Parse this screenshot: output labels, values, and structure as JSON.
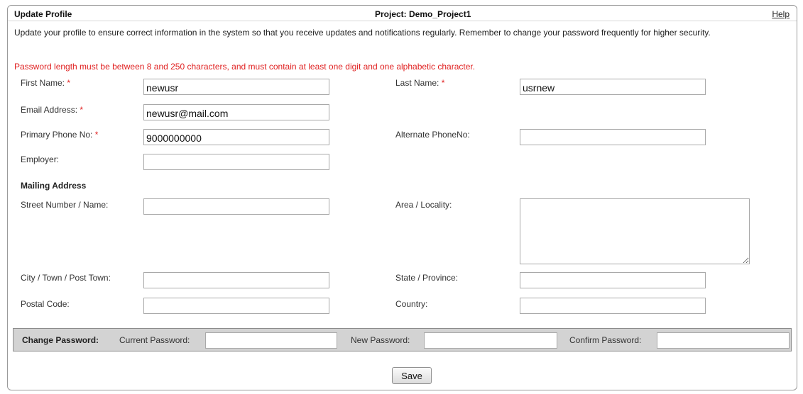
{
  "header": {
    "title": "Update Profile",
    "project": "Project: Demo_Project1",
    "help": "Help"
  },
  "intro_text": "Update your profile to ensure correct information in the system so that you receive updates and notifications regularly. Remember to change your password frequently for higher security.",
  "password_rule": "Password length must be between 8 and 250 characters, and must contain at least one digit and one alphabetic character.",
  "required_marker": "*",
  "fields": {
    "first_name": {
      "label": "First Name:",
      "value": "newusr"
    },
    "last_name": {
      "label": "Last Name:",
      "value": "usrnew"
    },
    "email": {
      "label": "Email Address:",
      "value": "newusr@mail.com"
    },
    "primary_phone": {
      "label": "Primary Phone No:",
      "value": "9000000000"
    },
    "alternate_phone": {
      "label": "Alternate PhoneNo:",
      "value": ""
    },
    "employer": {
      "label": "Employer:",
      "value": ""
    }
  },
  "mailing": {
    "heading": "Mailing Address",
    "street": {
      "label": "Street Number / Name:",
      "value": ""
    },
    "area": {
      "label": "Area / Locality:",
      "value": ""
    },
    "city": {
      "label": "City / Town / Post Town:",
      "value": ""
    },
    "state": {
      "label": "State / Province:",
      "value": ""
    },
    "postal": {
      "label": "Postal Code:",
      "value": ""
    },
    "country": {
      "label": "Country:",
      "value": ""
    }
  },
  "change_password": {
    "heading": "Change Password:",
    "current_label": "Current Password:",
    "new_label": "New Password:",
    "confirm_label": "Confirm Password:"
  },
  "save_label": "Save"
}
